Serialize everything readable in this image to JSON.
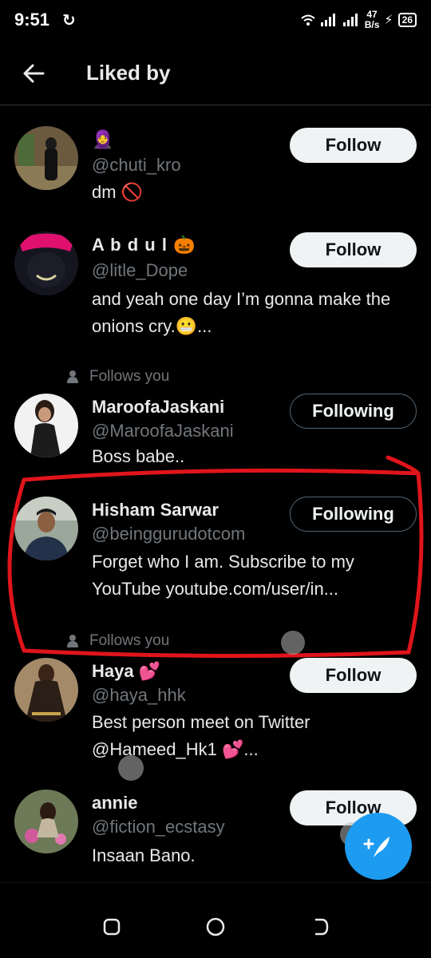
{
  "status_bar": {
    "time": "9:51",
    "sync_icon": "↻",
    "net_speed_value": "47",
    "net_speed_unit": "B/s",
    "battery": "26"
  },
  "header": {
    "title": "Liked by"
  },
  "users": [
    {
      "name": "🧕",
      "handle": "@chuti_kro",
      "bio": "dm 🚫",
      "button": "Follow",
      "follows_you": ""
    },
    {
      "name": "A b d u l 🎃",
      "handle": "@litle_Dope",
      "bio": "and yeah one day I’m gonna make the onions cry.😬...",
      "button": "Follow",
      "follows_you": ""
    },
    {
      "name": "MaroofaJaskani",
      "handle": "@MaroofaJaskani",
      "bio": "Boss babe..",
      "button": "Following",
      "follows_you": "Follows you"
    },
    {
      "name": "Hisham Sarwar",
      "handle": "@beinggurudotcom",
      "bio": "Forget who I am. Subscribe to my YouTube youtube.com/user/in...",
      "button": "Following",
      "follows_you": ""
    },
    {
      "name": "Haya 💕",
      "handle": "@haya_hhk",
      "bio": "Best person meet on Twitter @Hameed_Hk1 💕...",
      "button": "Follow",
      "follows_you": "Follows you"
    },
    {
      "name": "annie",
      "handle": "@fiction_ecstasy",
      "bio": "Insaan Bano.",
      "button": "Follow",
      "follows_you": ""
    }
  ],
  "colors": {
    "background": "#000000",
    "accent": "#1d9bf0",
    "annotation": "#e0141b"
  }
}
